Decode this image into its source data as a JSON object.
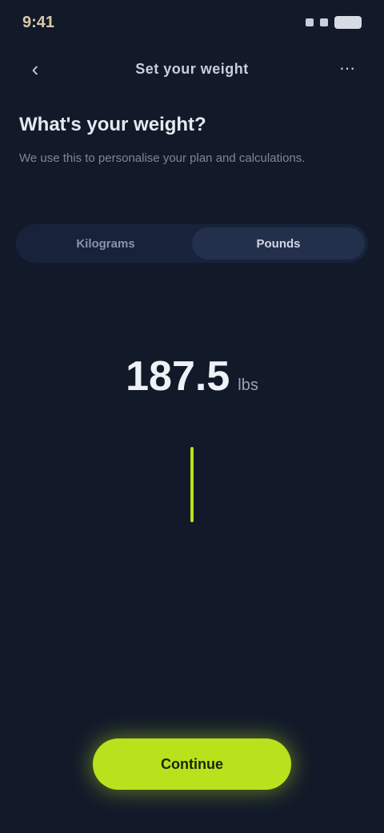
{
  "status_bar": {
    "time": "9:41",
    "icons": [
      "signal-icon",
      "wifi-icon",
      "battery-icon"
    ]
  },
  "nav": {
    "back_icon": "chevron-left-icon",
    "title": "Set your weight",
    "action_icon": "more-icon"
  },
  "heading": "What's your weight?",
  "description": "We use this to personalise your plan and calculations.",
  "segmented": {
    "options": [
      "Kilograms",
      "Pounds"
    ],
    "selected": 1
  },
  "value": {
    "number": "187.5",
    "unit": "lbs"
  },
  "dial": {
    "selected_value": 187.5,
    "accent_color": "#b8e21c"
  },
  "primary_button": {
    "label": "Continue"
  },
  "colors": {
    "background": "#121a2a",
    "accent": "#b8e21c"
  }
}
